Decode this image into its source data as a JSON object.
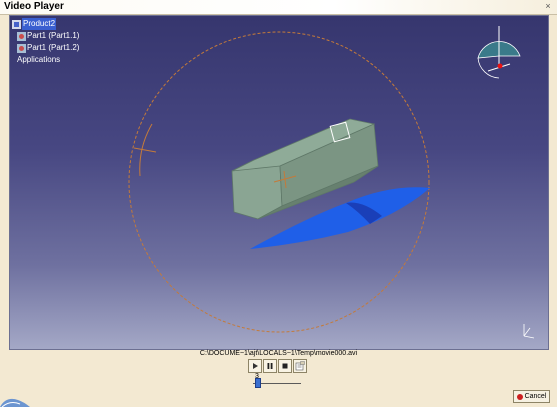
{
  "window": {
    "title": "Video Player",
    "close_glyph": "×"
  },
  "tree": {
    "root": "Product2",
    "children": [
      "Part1 (Part1.1)",
      "Part1 (Part1.2)"
    ],
    "applications": "Applications"
  },
  "file_path": "C:\\DOCUME~1\\ajt\\LOCALS~1\\Temp\\movie000.avi",
  "controls": {
    "play_icon": "play-icon",
    "pause_icon": "pause-icon",
    "stop_icon": "stop-icon",
    "settings_icon": "settings-icon"
  },
  "slider": {
    "value": "3"
  },
  "cancel_label": "Cancel",
  "colors": {
    "viewport_top": "#36366e",
    "viewport_bottom": "#a4a8c6",
    "part_body": "#7f9b8a",
    "blue_surface": "#1f5fe8",
    "orbit_circle": "#c47a3a",
    "selection": "#3a5fd0"
  }
}
